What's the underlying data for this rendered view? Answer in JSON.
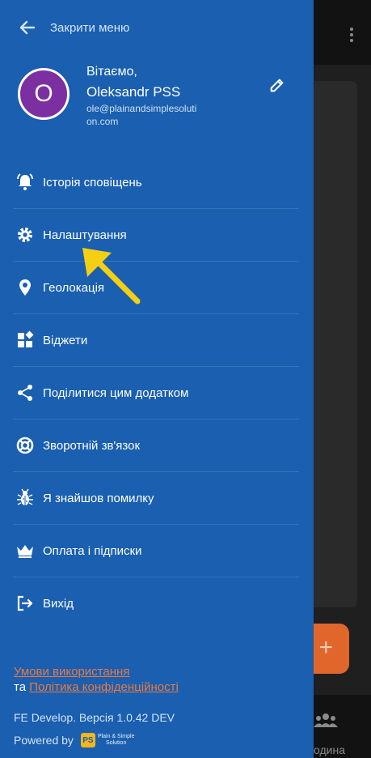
{
  "background": {
    "fab_label": "+",
    "bottom_nav_label": "одина"
  },
  "drawer": {
    "close_label": "Закрити меню",
    "profile": {
      "avatar_letter": "O",
      "greeting": "Вітаємо,",
      "name": "Oleksandr PSS",
      "email": "ole@plainandsimplesolution.com"
    },
    "menu_items": [
      {
        "label": "Історія сповіщень",
        "icon": "bell-icon"
      },
      {
        "label": "Налаштування",
        "icon": "gear-icon"
      },
      {
        "label": "Геолокація",
        "icon": "location-pin-icon"
      },
      {
        "label": "Віджети",
        "icon": "widgets-icon"
      },
      {
        "label": "Поділитися цим додатком",
        "icon": "share-icon"
      },
      {
        "label": "Зворотній зв'язок",
        "icon": "lifebuoy-icon"
      },
      {
        "label": "Я знайшов помилку",
        "icon": "bug-icon"
      },
      {
        "label": "Оплата і підписки",
        "icon": "crown-icon"
      },
      {
        "label": "Вихід",
        "icon": "logout-icon"
      }
    ],
    "footer": {
      "terms_link": "Умови використання",
      "and_text": "та",
      "privacy_link": "Політика конфіденційності",
      "version": "FE Develop. Версія 1.0.42 DEV",
      "powered_by": "Powered by",
      "logo_badge": "PS",
      "logo_text_line1": "Plain & Simple",
      "logo_text_line2": "Solution"
    }
  },
  "colors": {
    "drawer_bg": "#1a5fb0",
    "link": "#e87a40",
    "avatar": "#7b2fa0",
    "annotation_arrow": "#f4cf12"
  }
}
